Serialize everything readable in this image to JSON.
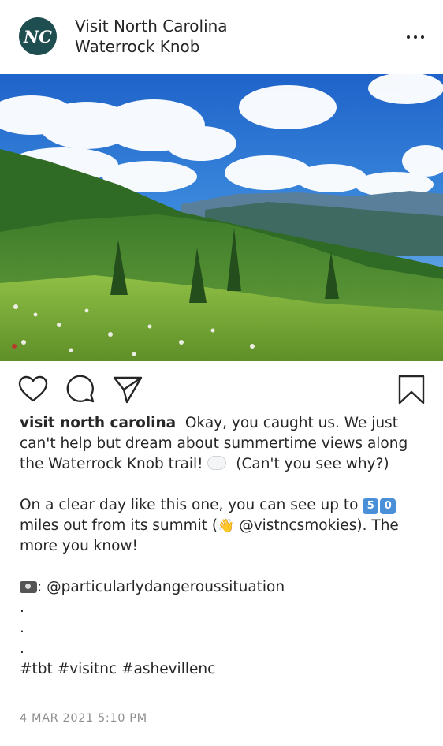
{
  "header": {
    "account_name": "Visit North Carolina",
    "location": "Waterrock Knob",
    "avatar_initials": "NC",
    "more_icon": "more-horizontal-icon"
  },
  "photo": {
    "subject": "mountain-landscape"
  },
  "actions": {
    "like_icon": "heart-icon",
    "comment_icon": "comment-icon",
    "share_icon": "paper-plane-icon",
    "save_icon": "bookmark-icon"
  },
  "caption": {
    "username": "visit north carolina",
    "p1_text": "Okay, you caught us. We just can't help but dream about summertime views along the Waterrock Knob trail!",
    "p1_tail": "(Can't you see why?)",
    "p2_start": "On a clear day like this one, you can see up to",
    "keycap_5": "5",
    "keycap_0": "0",
    "p2_mid": "miles out from its summit (",
    "wave_emoji": "👋",
    "p2_end": "@vistncsmokies). The more you know!",
    "credit": ": @particularlydangeroussituation",
    "dot1": ".",
    "dot2": ".",
    "dot3": ".",
    "hashtags": "#tbt #visitnc #ashevillenc"
  },
  "timestamp": "4 MAR 2021 5:10 PM",
  "colors": {
    "avatar": "#1f4e50",
    "text": "#262626",
    "muted": "#8e8e8e"
  }
}
